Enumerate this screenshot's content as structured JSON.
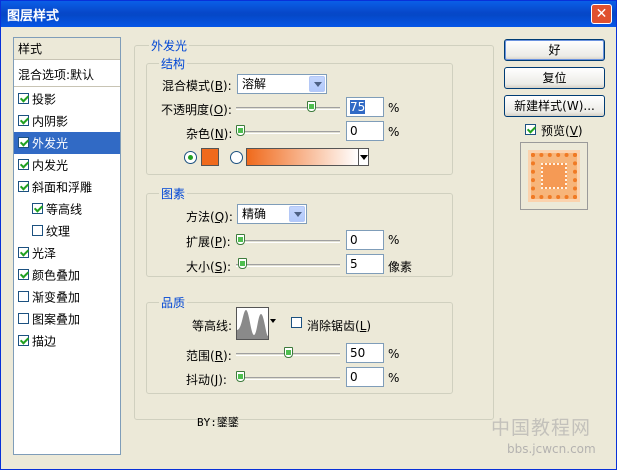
{
  "window": {
    "title": "图层样式",
    "close_label": "✕"
  },
  "styles_list": {
    "header": "样式",
    "blend_options": "混合选项:默认",
    "items": [
      {
        "label": "投影",
        "checked": true,
        "indent": false,
        "selected": false
      },
      {
        "label": "内阴影",
        "checked": true,
        "indent": false,
        "selected": false
      },
      {
        "label": "外发光",
        "checked": true,
        "indent": false,
        "selected": true
      },
      {
        "label": "内发光",
        "checked": true,
        "indent": false,
        "selected": false
      },
      {
        "label": "斜面和浮雕",
        "checked": true,
        "indent": false,
        "selected": false
      },
      {
        "label": "等高线",
        "checked": true,
        "indent": true,
        "selected": false
      },
      {
        "label": "纹理",
        "checked": false,
        "indent": true,
        "selected": false
      },
      {
        "label": "光泽",
        "checked": true,
        "indent": false,
        "selected": false
      },
      {
        "label": "颜色叠加",
        "checked": true,
        "indent": false,
        "selected": false
      },
      {
        "label": "渐变叠加",
        "checked": false,
        "indent": false,
        "selected": false
      },
      {
        "label": "图案叠加",
        "checked": false,
        "indent": false,
        "selected": false
      },
      {
        "label": "描边",
        "checked": true,
        "indent": false,
        "selected": false
      }
    ]
  },
  "outer_glow": {
    "title": "外发光",
    "structure": {
      "title": "结构",
      "blend_mode_label_pre": "混合模式(",
      "blend_mode_key": "B",
      "blend_mode_label_post": "):",
      "blend_mode_value": "溶解",
      "opacity_label_pre": "不透明度(",
      "opacity_key": "O",
      "opacity_label_post": "):",
      "opacity_value": "75",
      "opacity_level": 0.75,
      "opacity_unit": "%",
      "noise_label_pre": "杂色(",
      "noise_key": "N",
      "noise_label_post": "):",
      "noise_value": "0",
      "noise_level": 0,
      "noise_unit": "%",
      "glow_color": "#f06a1c",
      "color_mode": "solid",
      "gradient_from": "#f06a1c",
      "gradient_to": "#ffffff"
    },
    "elements": {
      "title": "图素",
      "technique_label_pre": "方法(",
      "technique_key": "Q",
      "technique_label_post": "):",
      "technique_value": "精确",
      "spread_label_pre": "扩展(",
      "spread_key": "P",
      "spread_label_post": "):",
      "spread_value": "0",
      "spread_level": 0,
      "spread_unit": "%",
      "size_label_pre": "大小(",
      "size_key": "S",
      "size_label_post": "):",
      "size_value": "5",
      "size_level": 0.02,
      "size_unit": "像素"
    },
    "quality": {
      "title": "品质",
      "contour_label": "等高线:",
      "antialias_label_pre": "消除锯齿(",
      "antialias_key": "L",
      "antialias_label_post": ")",
      "antialias_checked": false,
      "range_label_pre": "范围(",
      "range_key": "R",
      "range_label_post": "):",
      "range_value": "50",
      "range_level": 0.5,
      "range_unit": "%",
      "jitter_label_pre": "抖动(",
      "jitter_key": "J",
      "jitter_label_post": "):",
      "jitter_value": "0",
      "jitter_level": 0,
      "jitter_unit": "%"
    },
    "credit": "BY:鐆鐆"
  },
  "buttons": {
    "ok": "好",
    "reset": "复位",
    "new_style": "新建样式(W)...",
    "preview_label_pre": "预览(",
    "preview_key": "V",
    "preview_label_post": ")",
    "preview_checked": true
  },
  "watermark": {
    "line1": "中国教程网",
    "line2": "bbs.jcwcn.com"
  }
}
